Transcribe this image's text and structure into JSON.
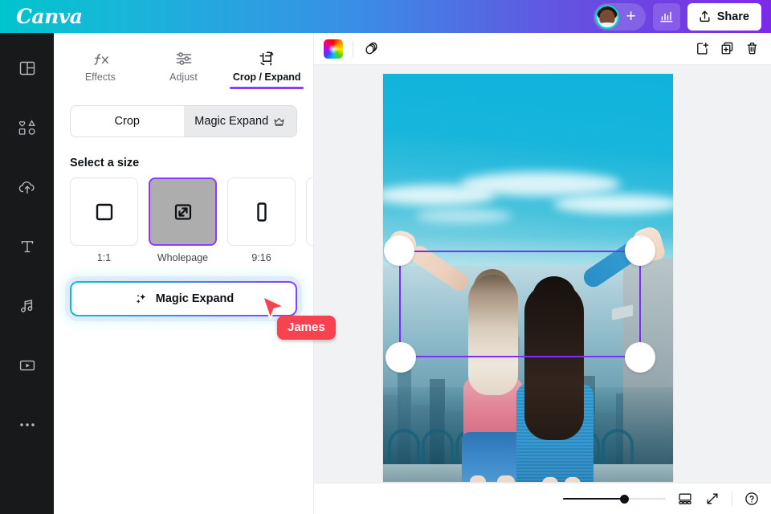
{
  "header": {
    "logo": "Canva",
    "avatar_name": "avatar",
    "add_collaborator_label": "+",
    "insights_icon": "bar-chart-icon",
    "share_label": "Share",
    "share_icon": "upload-icon"
  },
  "left_rail": {
    "items": [
      {
        "name": "design",
        "icon": "layout-grid-icon"
      },
      {
        "name": "elements",
        "icon": "shapes-icon"
      },
      {
        "name": "uploads",
        "icon": "cloud-upload-icon"
      },
      {
        "name": "text",
        "icon": "text-t-icon"
      },
      {
        "name": "audio",
        "icon": "music-note-icon"
      },
      {
        "name": "videos",
        "icon": "video-play-icon"
      },
      {
        "name": "more",
        "icon": "ellipsis-icon"
      }
    ]
  },
  "panel": {
    "tabs": [
      {
        "label": "Effects",
        "icon": "fx-icon",
        "active": false
      },
      {
        "label": "Adjust",
        "icon": "sliders-icon",
        "active": false
      },
      {
        "label": "Crop / Expand",
        "icon": "crop-expand-icon",
        "active": true
      }
    ],
    "segmented": {
      "crop_label": "Crop",
      "magic_expand_label": "Magic Expand",
      "magic_expand_badge_icon": "crown-icon",
      "active": "Magic Expand"
    },
    "section_title": "Select a size",
    "sizes": [
      {
        "label": "1:1",
        "icon": "square-icon",
        "selected": false
      },
      {
        "label": "Wholepage",
        "icon": "expand-arrows-icon",
        "selected": true
      },
      {
        "label": "9:16",
        "icon": "portrait-rect-icon",
        "selected": false
      },
      {
        "label": "",
        "icon": "partial-card",
        "selected": false
      }
    ],
    "magic_expand_button": {
      "label": "Magic Expand",
      "icon": "sparkles-icon"
    }
  },
  "cursor": {
    "name": "James",
    "color": "#f7434f"
  },
  "canvas": {
    "toolbar": {
      "color_swatch": "rainbow-color-icon",
      "transparency_icon": "transparency-icon",
      "add_page_icon": "add-page-icon",
      "duplicate_icon": "duplicate-icon",
      "delete_icon": "trash-icon"
    },
    "image_alt": "Two women with arms raised on a rooftop overlooking the New York City skyline",
    "crop_frame": {
      "border_color": "#7b2ff7",
      "handles": 4
    }
  },
  "bottom_bar": {
    "zoom_percent": 60,
    "pages_view_icon": "pages-grid-icon",
    "fullscreen_icon": "expand-arrows-diagonal-icon",
    "help_icon": "help-circle-icon"
  },
  "colors": {
    "brand_purple": "#8b3dff",
    "brand_teal": "#00c4cc",
    "crop_purple": "#7b2ff7",
    "cursor_red": "#f7434f"
  }
}
